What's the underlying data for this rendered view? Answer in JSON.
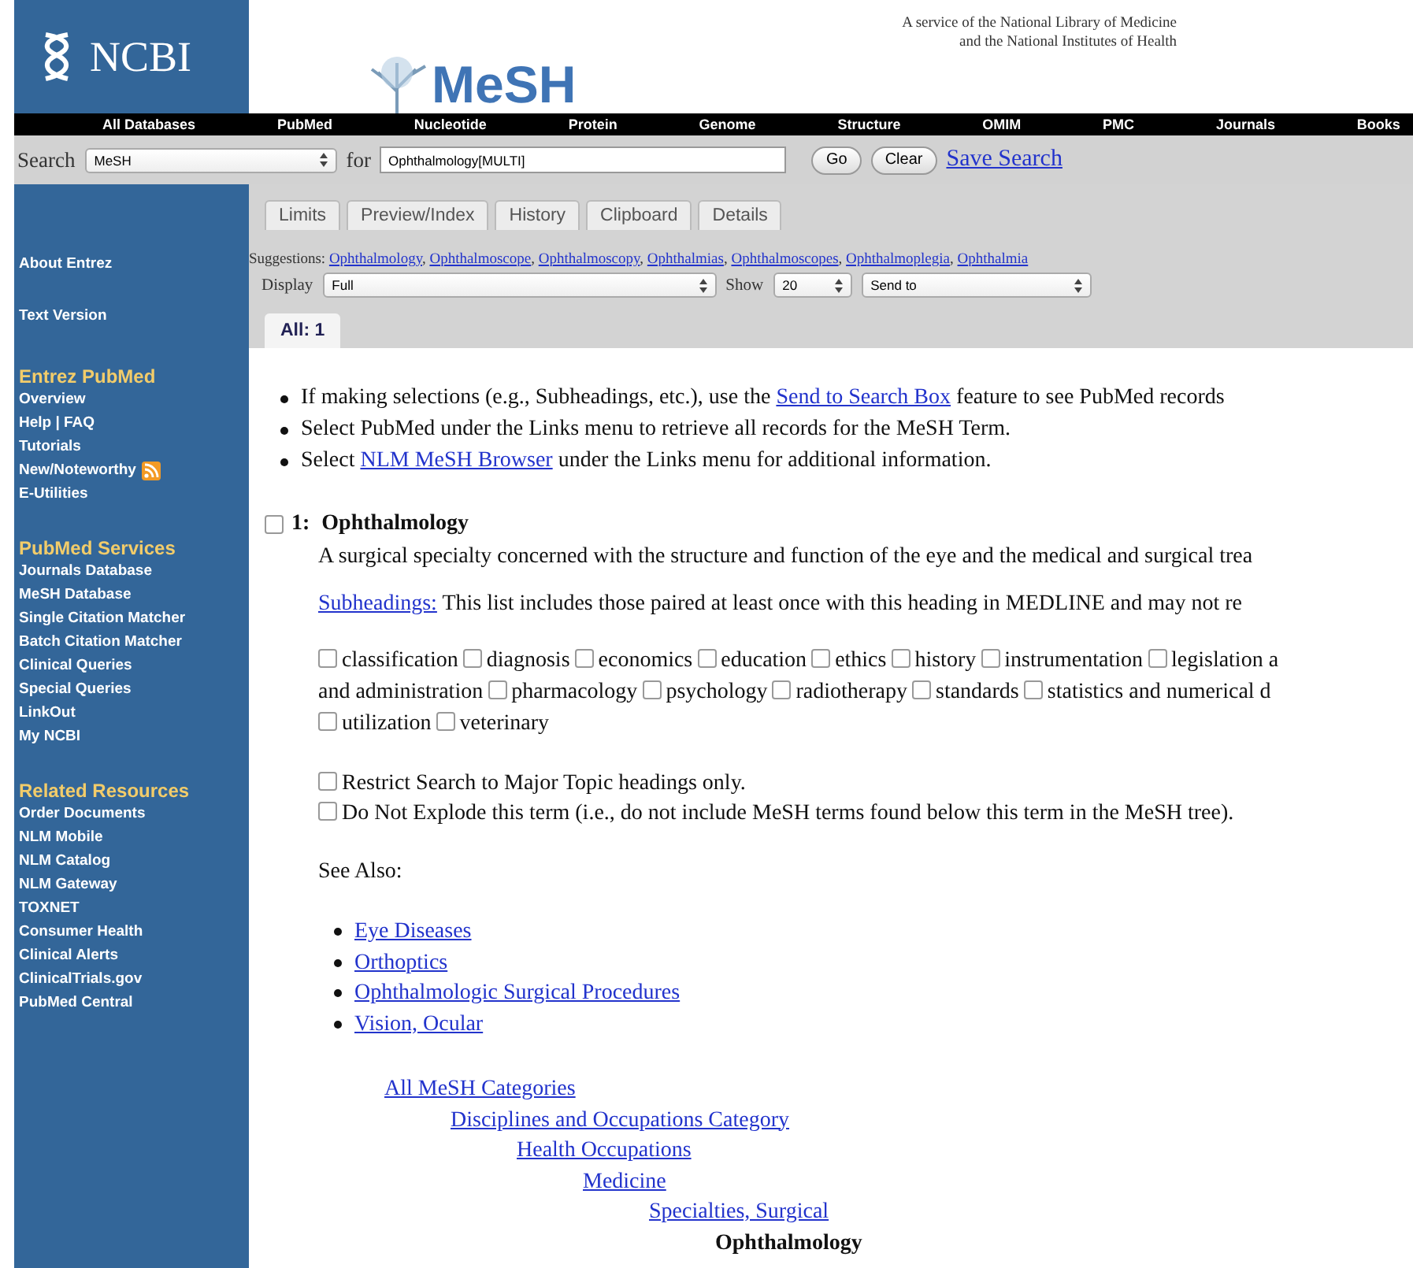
{
  "header": {
    "logo": "NCBI",
    "product": "MeSH",
    "service": [
      "A service of the National Library of Medicine",
      "and the National Institutes of Health"
    ]
  },
  "nav": [
    "All Databases",
    "PubMed",
    "Nucleotide",
    "Protein",
    "Genome",
    "Structure",
    "OMIM",
    "PMC",
    "Journals",
    "Books"
  ],
  "search": {
    "label": "Search",
    "database": "MeSH",
    "for": "for",
    "query": "Ophthalmology[MULTI]",
    "buttons": [
      "Go",
      "Clear"
    ],
    "save": "Save Search"
  },
  "tabs": [
    {
      "label": "Limits"
    },
    {
      "label": "Preview/Index"
    },
    {
      "label": "History"
    },
    {
      "label": "Clipboard"
    },
    {
      "label": "Details"
    }
  ],
  "sidebar": {
    "top": [
      "About Entrez",
      "Text Version"
    ],
    "sections": [
      {
        "heading": "Entrez PubMed",
        "items": [
          {
            "label": "Overview",
            "rss": false
          },
          {
            "label": "Help | FAQ",
            "rss": false
          },
          {
            "label": "Tutorials",
            "rss": false
          },
          {
            "label": "New/Noteworthy",
            "rss": true
          },
          {
            "label": "E-Utilities",
            "rss": false
          }
        ]
      },
      {
        "heading": "PubMed Services",
        "items": [
          {
            "label": "Journals Database",
            "rss": false
          },
          {
            "label": "MeSH Database",
            "rss": false
          },
          {
            "label": "Single Citation Matcher",
            "rss": false
          },
          {
            "label": "Batch Citation Matcher",
            "rss": false
          },
          {
            "label": "Clinical Queries",
            "rss": false
          },
          {
            "label": "Special Queries",
            "rss": false
          },
          {
            "label": "LinkOut",
            "rss": false
          },
          {
            "label": "My NCBI",
            "rss": false
          }
        ]
      },
      {
        "heading": "Related Resources",
        "items": [
          {
            "label": "Order Documents",
            "rss": false
          },
          {
            "label": "NLM Mobile",
            "rss": false
          },
          {
            "label": "NLM Catalog",
            "rss": false
          },
          {
            "label": "NLM Gateway",
            "rss": false
          },
          {
            "label": "TOXNET",
            "rss": false
          },
          {
            "label": "Consumer Health",
            "rss": false
          },
          {
            "label": "Clinical Alerts",
            "rss": false
          },
          {
            "label": "ClinicalTrials.gov",
            "rss": false
          },
          {
            "label": "PubMed Central",
            "rss": false
          }
        ]
      }
    ]
  },
  "suggestions": {
    "label": "Suggestions:",
    "separator": ",",
    "items": [
      "Ophthalmology",
      "Ophthalmoscope",
      "Ophthalmoscopy",
      "Ophthalmias",
      "Ophthalmoscopes",
      "Ophthalmoplegia",
      "Ophthalmia"
    ]
  },
  "display": {
    "label": "Display",
    "value": "Full",
    "show_label": "Show",
    "show_value": "20",
    "send": "Send to"
  },
  "results_tab": "All: 1",
  "tips": [
    {
      "before": "If making selections (e.g., Subheadings, etc.), use the ",
      "link": "Send to Search Box",
      "after": " feature to see PubMed records"
    },
    {
      "before": "Select PubMed under the Links menu to retrieve all records for the MeSH Term."
    },
    {
      "before": "Select ",
      "link": "NLM MeSH Browser",
      "after": " under the Links menu for additional information."
    }
  ],
  "record": {
    "number": "1:",
    "title": "Ophthalmology",
    "checked": false,
    "definition": "A surgical specialty concerned with the structure and function of the eye and the medical and surgical trea",
    "subheadings_link": "Subheadings:",
    "subheadings_note": "This list includes those paired at least once with this heading in MEDLINE and may not re",
    "subheading_lines": [
      [
        {
          "kind": "checkbox",
          "label": "classification",
          "checked": false
        },
        {
          "kind": "checkbox",
          "label": "diagnosis",
          "checked": false
        },
        {
          "kind": "checkbox",
          "label": "economics",
          "checked": false
        },
        {
          "kind": "checkbox",
          "label": "education",
          "checked": false
        },
        {
          "kind": "checkbox",
          "label": "ethics",
          "checked": false
        },
        {
          "kind": "checkbox",
          "label": "history",
          "checked": false
        },
        {
          "kind": "checkbox",
          "label": "instrumentation",
          "checked": false
        },
        {
          "kind": "checkbox",
          "label": "legislation a",
          "checked": false
        }
      ],
      [
        {
          "kind": "text",
          "label": "and administration"
        },
        {
          "kind": "checkbox",
          "label": "pharmacology",
          "checked": false
        },
        {
          "kind": "checkbox",
          "label": "psychology",
          "checked": false
        },
        {
          "kind": "checkbox",
          "label": "radiotherapy",
          "checked": false
        },
        {
          "kind": "checkbox",
          "label": "standards",
          "checked": false
        },
        {
          "kind": "checkbox",
          "label": "statistics and numerical d",
          "checked": false
        }
      ],
      [
        {
          "kind": "checkbox",
          "label": "utilization",
          "checked": false
        },
        {
          "kind": "checkbox",
          "label": "veterinary",
          "checked": false
        }
      ]
    ],
    "options": [
      {
        "label": "Restrict Search to Major Topic headings only.",
        "checked": false
      },
      {
        "label": "Do Not Explode this term (i.e., do not include MeSH terms found below this term in the MeSH tree).",
        "checked": false
      }
    ],
    "see_also_label": "See Also:",
    "see_also": [
      "Eye Diseases",
      "Orthoptics",
      "Ophthalmologic Surgical Procedures",
      "Vision, Ocular"
    ],
    "tree": [
      {
        "label": "All MeSH Categories",
        "current": false,
        "children": [
          {
            "label": "Disciplines and Occupations Category",
            "current": false,
            "children": [
              {
                "label": "Health Occupations",
                "current": false,
                "children": [
                  {
                    "label": "Medicine",
                    "current": false,
                    "children": [
                      {
                        "label": "Specialties, Surgical",
                        "current": false,
                        "children": [
                          {
                            "label": "Ophthalmology",
                            "current": true
                          }
                        ]
                      }
                    ]
                  }
                ]
              }
            ]
          }
        ]
      }
    ]
  }
}
